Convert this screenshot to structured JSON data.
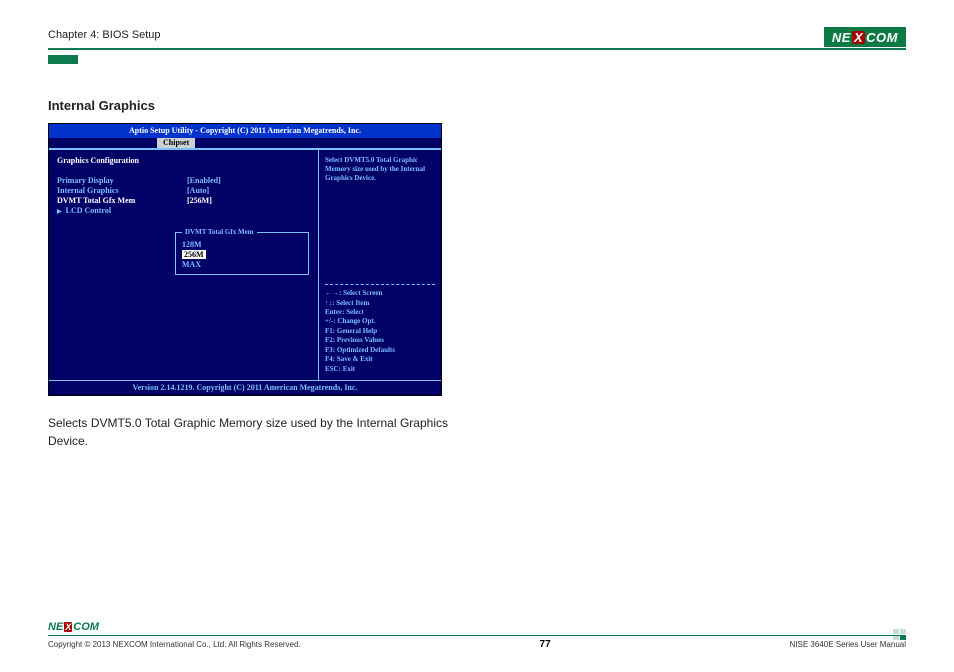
{
  "header": {
    "chapter": "Chapter 4: BIOS Setup",
    "logo_pre": "NE",
    "logo_x": "X",
    "logo_post": "COM"
  },
  "section": {
    "title": "Internal Graphics"
  },
  "bios": {
    "top": "Aptio Setup Utility - Copyright (C) 2011 American Megatrends, Inc.",
    "tab": "Chipset",
    "cfg_title": "Graphics Configuration",
    "rows": [
      {
        "label": "Primary Display",
        "value": "[Enabled]"
      },
      {
        "label": "Internal Graphics",
        "value": "[Auto]"
      },
      {
        "label": "DVMT Total Gfx Mem",
        "value": "[256M]"
      },
      {
        "label": "LCD Control",
        "value": ""
      }
    ],
    "popup": {
      "title": "DVMT Total Gfx Mem",
      "items": [
        "128M",
        "256M",
        "MAX"
      ],
      "selected_index": 1
    },
    "help": "Select DVMT5.0 Total Graphic Memory size used by the Internal Graphics Device.",
    "keys": [
      "←→: Select Screen",
      "↑↓: Select Item",
      "Enter: Select",
      "+/-: Change Opt.",
      "F1: General Help",
      "F2: Previous Values",
      "F3: Optimized Defaults",
      "F4: Save & Exit",
      "ESC: Exit"
    ],
    "footer": "Version 2.14.1219. Copyright (C) 2011 American Megatrends, Inc."
  },
  "description": "Selects DVMT5.0 Total Graphic Memory size used by the Internal Graphics Device.",
  "footer": {
    "copyright": "Copyright © 2013 NEXCOM International Co., Ltd. All Rights Reserved.",
    "page": "77",
    "manual": "NISE 3640E Series User Manual"
  }
}
